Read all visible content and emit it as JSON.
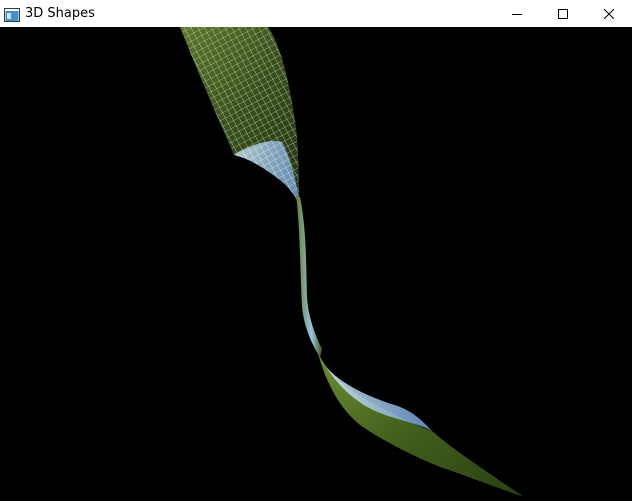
{
  "window": {
    "title": "3D Shapes",
    "icon": "app-window-icon",
    "controls": {
      "minimize": "minimize-icon",
      "maximize": "maximize-icon",
      "close": "close-icon"
    }
  },
  "viewport": {
    "background": "#000000",
    "shape": "textured-wireframe-surface",
    "colors": {
      "grass_dark": "#3f5a1c",
      "grass_light": "#7a9a3a",
      "sky": "#8fb8e0",
      "wire": "#dfe9f5"
    }
  }
}
